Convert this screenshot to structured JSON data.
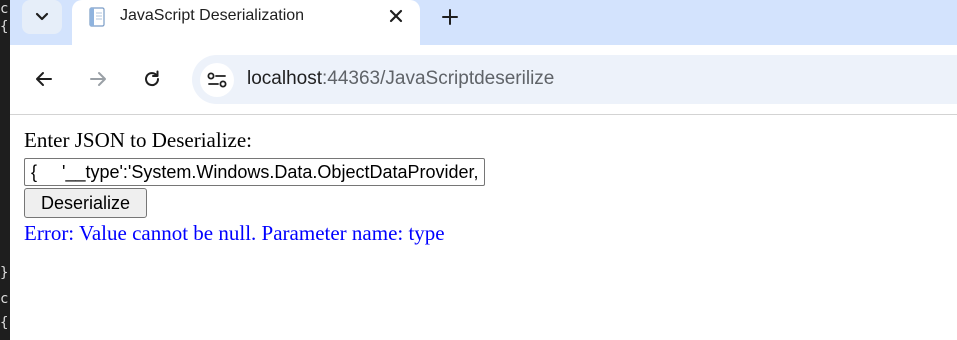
{
  "background_editor": {
    "glyphs": [
      "c",
      "{",
      "}",
      "c",
      "{"
    ]
  },
  "browser": {
    "tab": {
      "title": "JavaScript Deserialization",
      "favicon": "document-icon"
    },
    "omnibox": {
      "host": "localhost",
      "path": ":44363/JavaScriptdeserilize"
    }
  },
  "page": {
    "prompt_label": "Enter JSON to Deserialize:",
    "json_input_value": "{     '__type':'System.Windows.Data.ObjectDataProvider, PresentationFramework'",
    "deserialize_button": "Deserialize",
    "error_message": "Error: Value cannot be null. Parameter name: type"
  },
  "colors": {
    "tabstrip_bg": "#d3e3fd",
    "omnibox_bg": "#edf2fa",
    "error_text": "#0000ff"
  }
}
